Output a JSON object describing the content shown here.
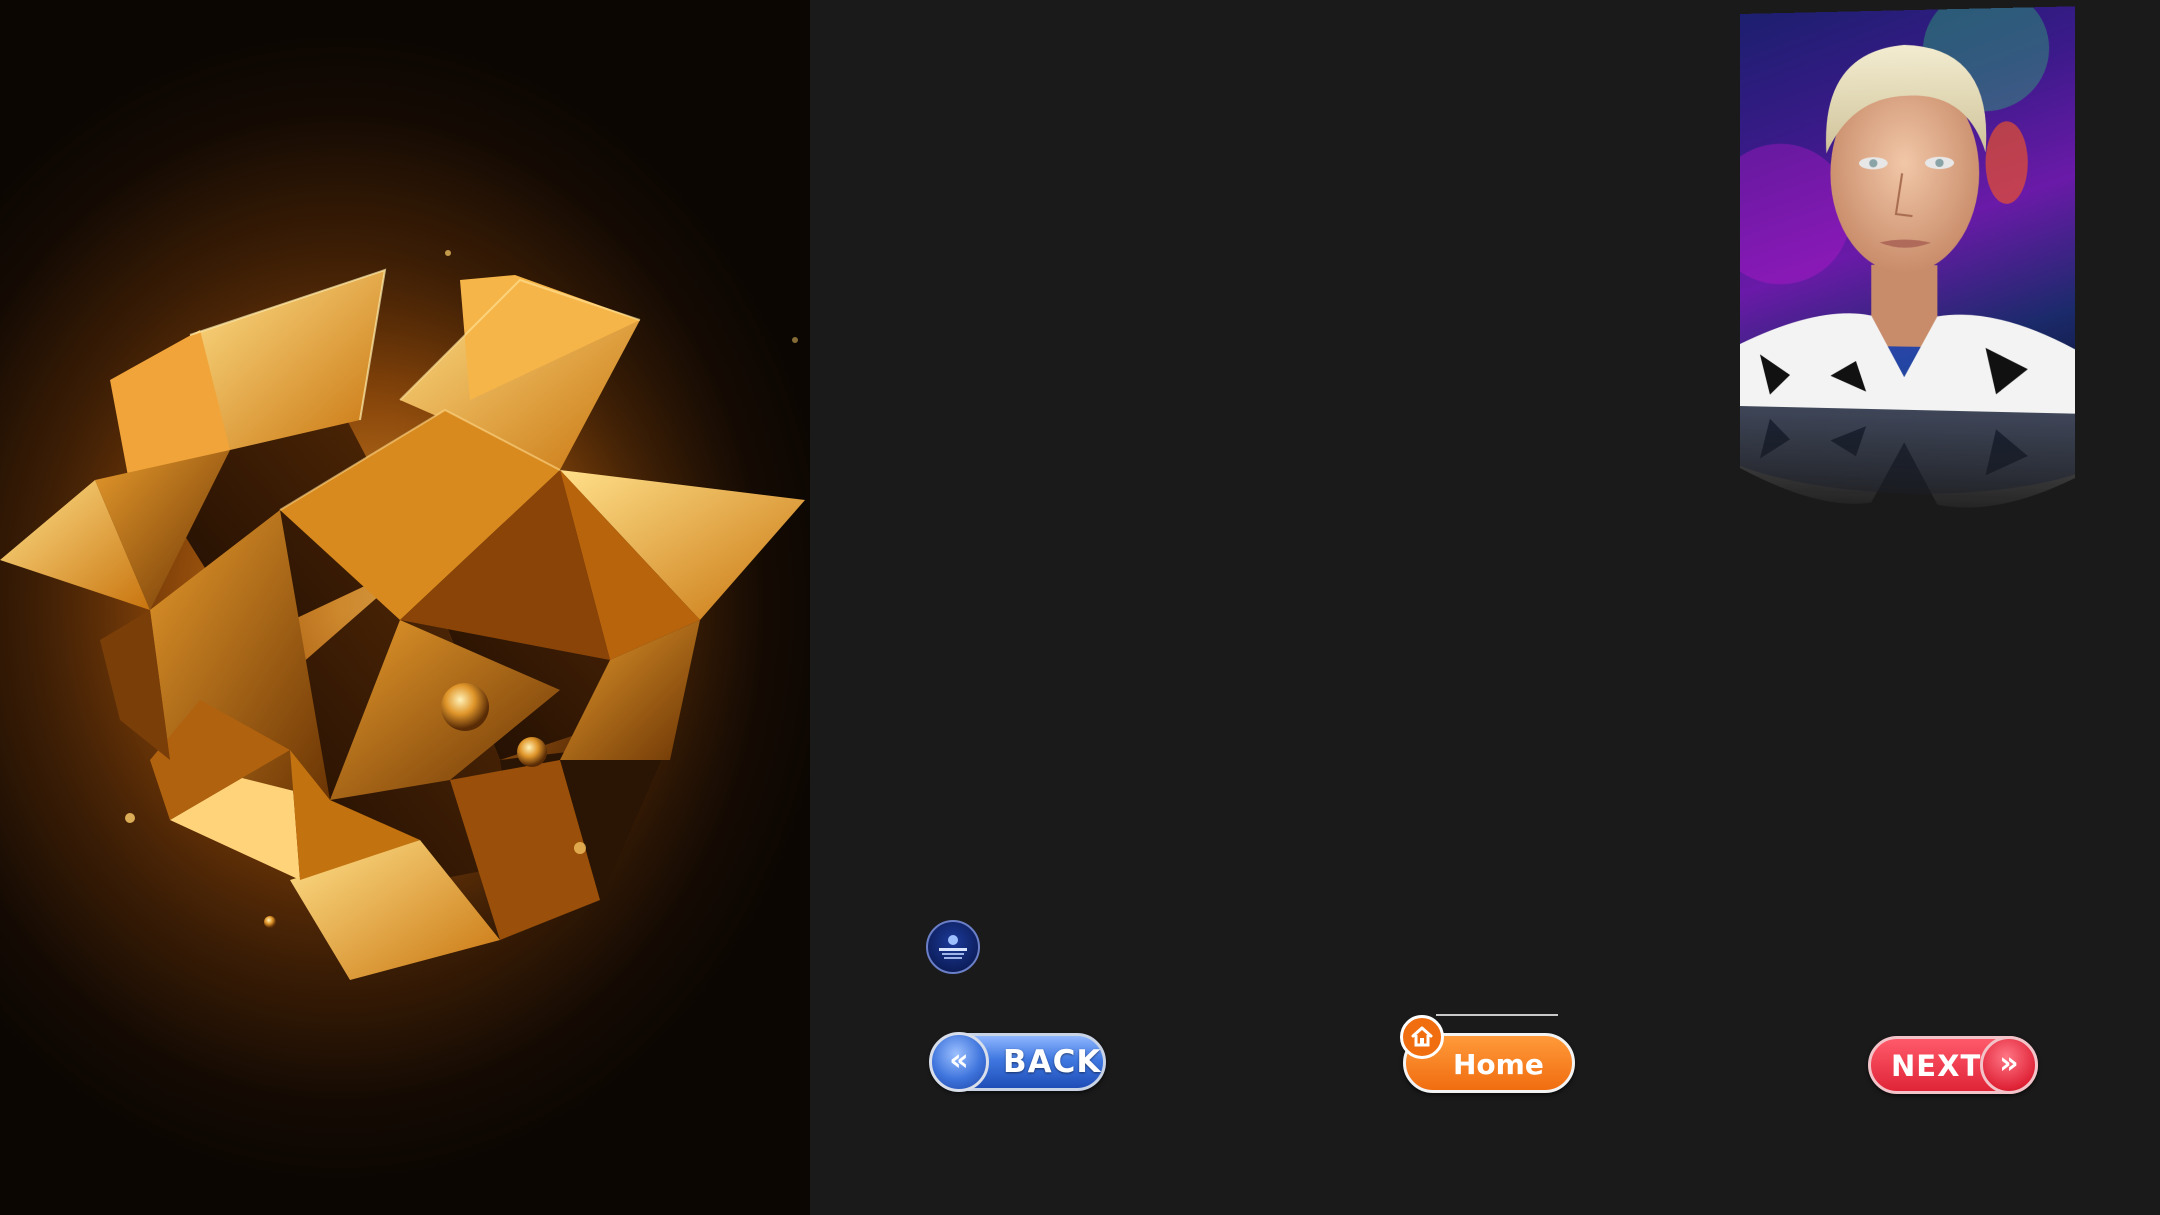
{
  "slide": {
    "artwork": {
      "icon": "golden-polyhedron-artwork",
      "accent_color": "#f0a020"
    },
    "portrait": {
      "icon": "portrait-photo"
    },
    "badge": {
      "icon": "emblem-badge-icon"
    }
  },
  "navigation": {
    "back": {
      "label": "BACK",
      "icon": "double-chevron-left-icon",
      "color": "#3f78e0"
    },
    "home": {
      "label": "Home",
      "icon": "home-icon",
      "color": "#f06d10"
    },
    "next": {
      "label": "NEXT",
      "icon": "double-chevron-right-icon",
      "color": "#e02438"
    }
  }
}
